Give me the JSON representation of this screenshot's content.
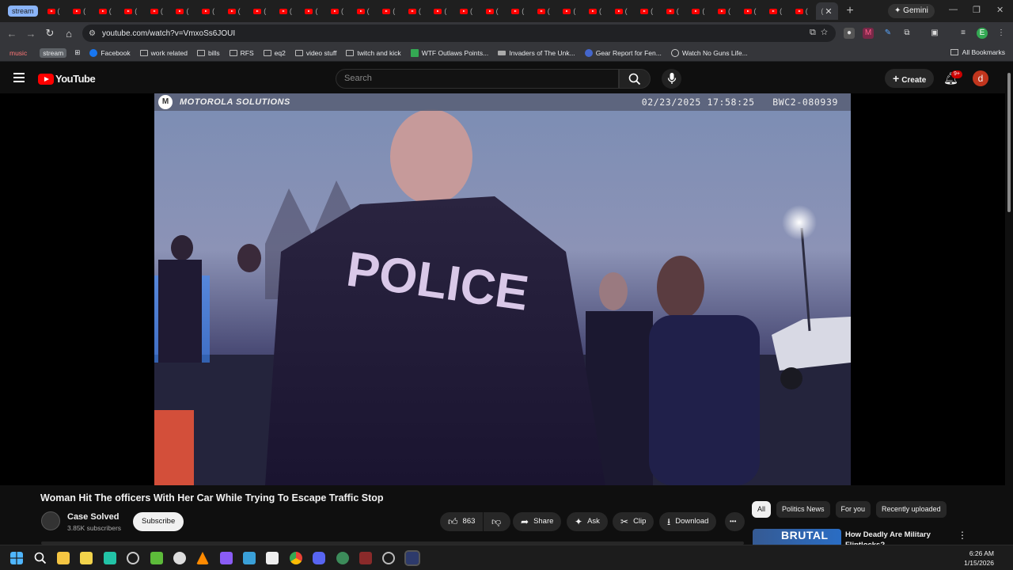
{
  "browser": {
    "tab_group_label": "stream",
    "tab_paren": "(",
    "new_tab": "+",
    "gemini_label": "Gemini",
    "url": "youtube.com/watch?v=VmxoSs6JOUI",
    "bookmarks": [
      {
        "label": "music",
        "kind": "pill-red"
      },
      {
        "label": "stream",
        "kind": "pill"
      },
      {
        "label": "Facebook",
        "kind": "fb"
      },
      {
        "label": "work related",
        "kind": "folder"
      },
      {
        "label": "bills",
        "kind": "folder"
      },
      {
        "label": "RFS",
        "kind": "folder"
      },
      {
        "label": "eq2",
        "kind": "folder"
      },
      {
        "label": "video stuff",
        "kind": "folder"
      },
      {
        "label": "twitch and kick",
        "kind": "folder"
      },
      {
        "label": "WTF Outlaws Points...",
        "kind": "green"
      },
      {
        "label": "Invaders of The Unk...",
        "kind": "gray"
      },
      {
        "label": "Gear Report for Fen...",
        "kind": "logo"
      },
      {
        "label": "Watch No Guns Life...",
        "kind": "round"
      }
    ],
    "all_bookmarks": "All Bookmarks"
  },
  "youtube": {
    "logo_text": "YouTube",
    "search_placeholder": "Search",
    "create_label": "Create",
    "notif_badge": "9+",
    "avatar_letter": "d"
  },
  "video": {
    "brand": "MOTOROLA SOLUTIONS",
    "timestamp": "02/23/2025 17:58:25",
    "camera_id": "BWC2-080939",
    "jacket_text": "POLICE",
    "title": "Woman Hit The officers With Her Car While Trying To Escape Traffic Stop"
  },
  "channel": {
    "name": "Case Solved",
    "subscribers": "3.85K subscribers",
    "subscribe_label": "Subscribe"
  },
  "actions": {
    "likes": "863",
    "share": "Share",
    "ask": "Ask",
    "clip": "Clip",
    "download": "Download",
    "more": "•••"
  },
  "chips": [
    "All",
    "Politics News",
    "For you",
    "Recently uploaded"
  ],
  "recommendation": {
    "thumb_text": "BRUTAL",
    "title": "How Deadly Are Military Flintlocks?"
  },
  "taskbar": {
    "time": "6:26 AM",
    "date": "1/15/2026"
  },
  "colors": {
    "yt_red": "#ff0000",
    "bg": "#0f0f0f",
    "accent_blue": "#8ab4f8"
  }
}
